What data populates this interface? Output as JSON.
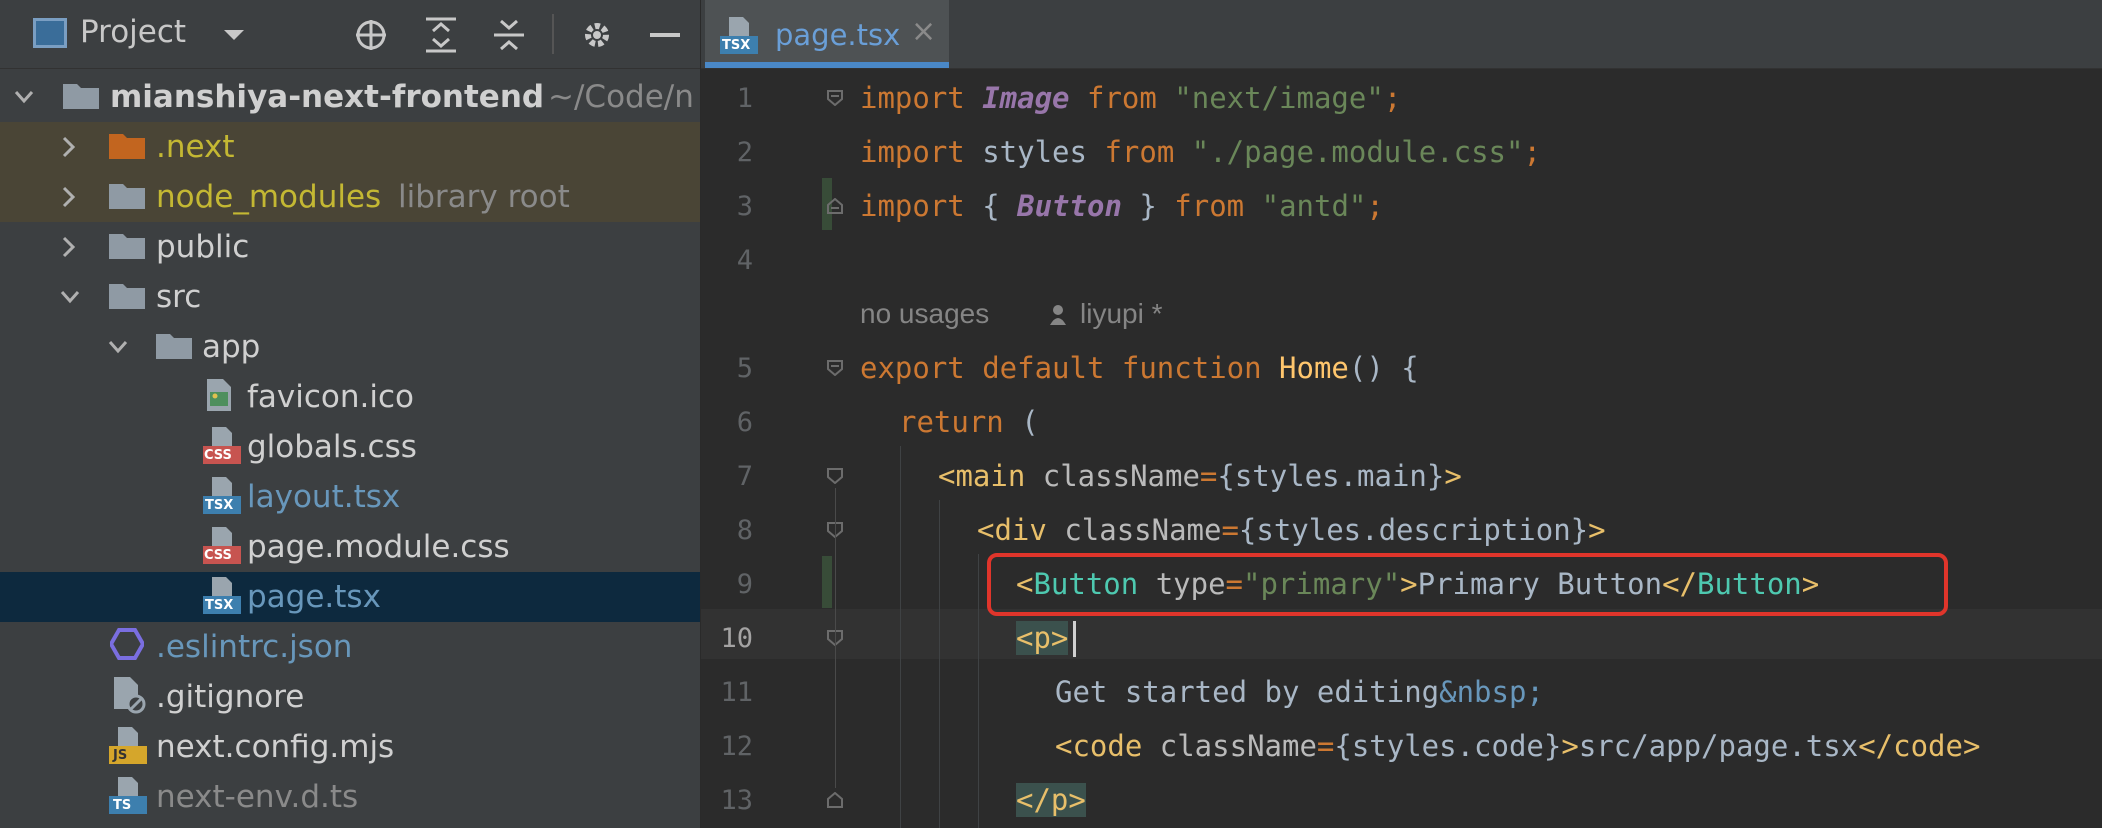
{
  "sidebar": {
    "title": "Project",
    "rows": [
      {
        "name": "project-root",
        "label": "mianshiya-next-frontend",
        "hint": "~/Code/n"
      },
      {
        "name": "folder-next",
        "label": ".next"
      },
      {
        "name": "folder-node-modules",
        "label": "node_modules",
        "hint": "library root"
      },
      {
        "name": "folder-public",
        "label": "public"
      },
      {
        "name": "folder-src",
        "label": "src"
      },
      {
        "name": "folder-app",
        "label": "app"
      },
      {
        "name": "file-favicon",
        "label": "favicon.ico"
      },
      {
        "name": "file-globals-css",
        "label": "globals.css"
      },
      {
        "name": "file-layout-tsx",
        "label": "layout.tsx"
      },
      {
        "name": "file-page-module-css",
        "label": "page.module.css"
      },
      {
        "name": "file-page-tsx",
        "label": "page.tsx"
      },
      {
        "name": "file-eslintrc",
        "label": ".eslintrc.json"
      },
      {
        "name": "file-gitignore",
        "label": ".gitignore"
      },
      {
        "name": "file-next-config",
        "label": "next.config.mjs"
      },
      {
        "name": "file-next-env",
        "label": "next-env.d.ts"
      }
    ],
    "badges": {
      "tsx": "TSX",
      "css": "CSS",
      "js": "JS",
      "ts": "TS"
    }
  },
  "editor": {
    "tab_label": "page.tsx",
    "tab_close": "×",
    "line_numbers": [
      "1",
      "2",
      "3",
      "4",
      "5",
      "6",
      "7",
      "8",
      "9",
      "10",
      "11",
      "12",
      "13"
    ],
    "code_lens": {
      "usages": "no usages",
      "author": "liyupi *"
    },
    "code": {
      "l1": {
        "kw": "import ",
        "id": "Image",
        "kw2": " from ",
        "str": "\"next/image\"",
        "end": ";"
      },
      "l2": {
        "kw": "import ",
        "id": "styles",
        "kw2": " from ",
        "str": "\"./page.module.css\"",
        "end": ";"
      },
      "l3": {
        "kw": "import ",
        "p1": "{ ",
        "id": "Button",
        "p2": " } ",
        "kw2": "from ",
        "str": "\"antd\"",
        "end": ";"
      },
      "l5": {
        "kw": "export default function ",
        "fn": "Home",
        "rest": "() {"
      },
      "l6": {
        "kw": "return ",
        "rest": "("
      },
      "l7": {
        "open": "<main ",
        "attr": "className",
        "eq": "=",
        "val": "{styles.main}",
        "close": ">"
      },
      "l8": {
        "open": "<div ",
        "attr": "className",
        "eq": "=",
        "val": "{styles.description}",
        "close": ">"
      },
      "l9": {
        "lt": "<",
        "comp": "Button",
        "attr": " type",
        "eq": "=",
        "str": "\"primary\"",
        "gt": ">",
        "text": "Primary Button",
        "lt2": "</",
        "comp2": "Button",
        "gt2": ">"
      },
      "l10": {
        "tag": "<p>"
      },
      "l11": {
        "text": "Get started by editing",
        "ent": "&nbsp;"
      },
      "l12": {
        "open": "<code ",
        "attr": "className",
        "eq": "=",
        "val": "{styles.code}",
        "close": ">",
        "text": "src/app/page.tsx",
        "end": "</code>"
      },
      "l13": {
        "tag": "</p>"
      }
    }
  }
}
